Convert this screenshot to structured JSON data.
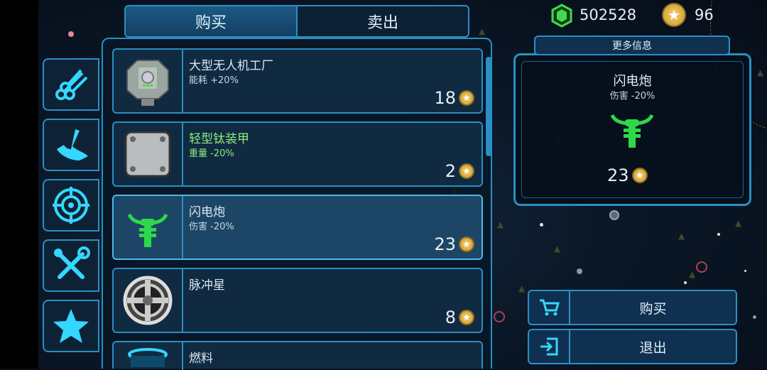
{
  "tabs": {
    "buy": "购买",
    "sell": "卖出",
    "active": "buy"
  },
  "resources": {
    "credits": "502528",
    "stars": "96"
  },
  "sidebar": [
    {
      "icon": "cables-icon"
    },
    {
      "icon": "hook-icon"
    },
    {
      "icon": "target-icon"
    },
    {
      "icon": "tools-icon"
    },
    {
      "icon": "star-icon"
    }
  ],
  "items": [
    {
      "name": "大型无人机工厂",
      "stat": "能耗 +20%",
      "price": "18",
      "highlight": false,
      "icon": "drone-factory-icon"
    },
    {
      "name": "轻型钛装甲",
      "stat": "重量 -20%",
      "price": "2",
      "highlight": true,
      "icon": "titanium-armor-icon"
    },
    {
      "name": "闪电炮",
      "stat": "伤害 -20%",
      "price": "23",
      "highlight": false,
      "selected": true,
      "icon": "lightning-cannon-icon"
    },
    {
      "name": "脉冲星",
      "stat": "",
      "price": "8",
      "highlight": false,
      "icon": "pulsar-icon"
    },
    {
      "name": "燃料",
      "stat": "",
      "price": "",
      "icon": "fuel-icon"
    }
  ],
  "info": {
    "header": "更多信息",
    "name": "闪电炮",
    "stat": "伤害 -20%",
    "price": "23"
  },
  "actions": {
    "buy": "购买",
    "exit": "退出"
  },
  "colors": {
    "accent": "#2a8fc4",
    "green": "#8df07a",
    "coin": "#e2b64a",
    "crystal": "#3fdc4a"
  }
}
